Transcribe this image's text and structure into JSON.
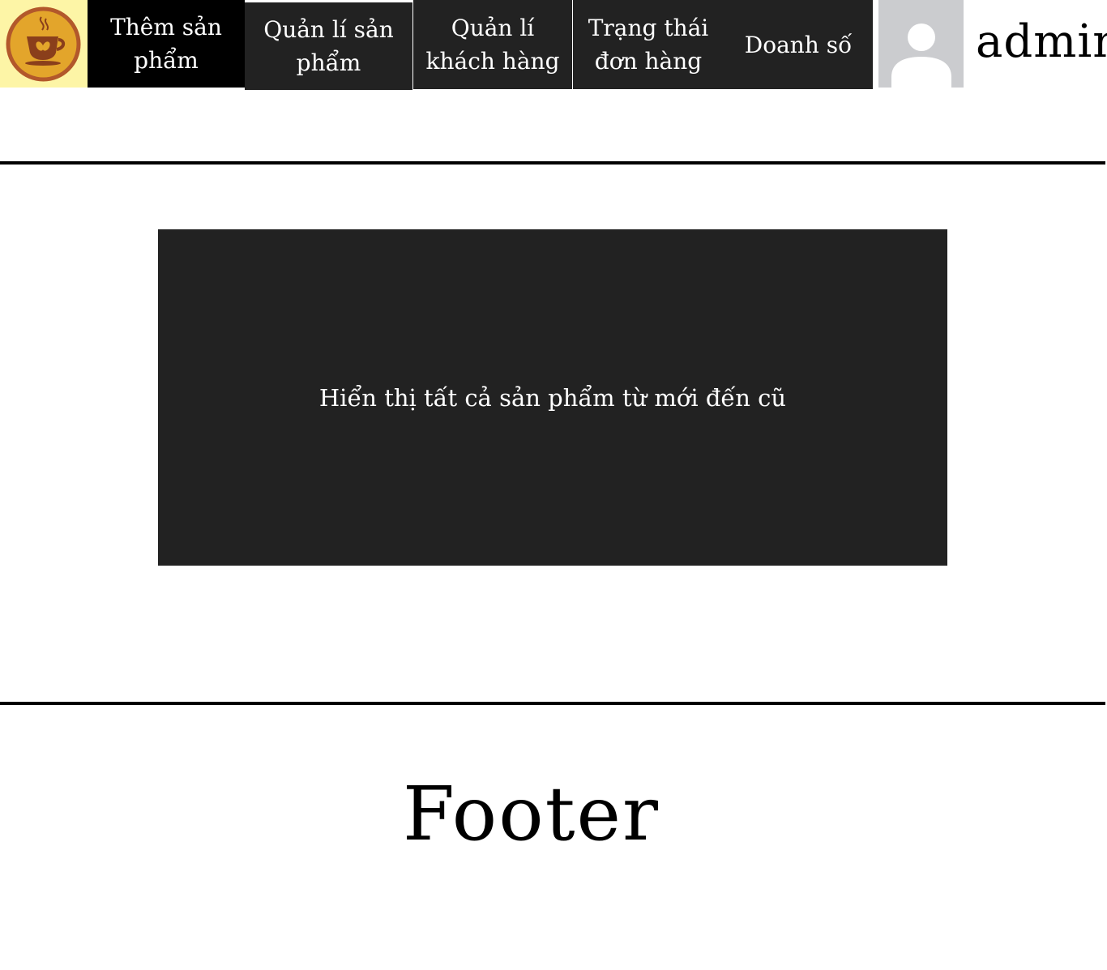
{
  "header": {
    "logo_icon": "coffee-cup-logo",
    "nav": {
      "add_product": "Thêm sản phẩm",
      "manage_products": "Quản lí sản phẩm",
      "manage_customers": "Quản lí khách hàng",
      "order_status": "Trạng thái đơn hàng",
      "sales": "Doanh số"
    },
    "avatar_icon": "user-placeholder-icon",
    "username": "admin"
  },
  "main": {
    "panel_text": "Hiển thị tất cả sản phẩm từ mới đến cũ"
  },
  "footer": {
    "text": "Footer"
  },
  "colors": {
    "logo_background": "#fdf5a6",
    "nav_active": "#000000",
    "nav_default": "#222222",
    "panel": "#222222",
    "avatar_background": "#cbcccf",
    "logo_ring": "#e3a52b",
    "logo_inner": "#b2582b"
  }
}
